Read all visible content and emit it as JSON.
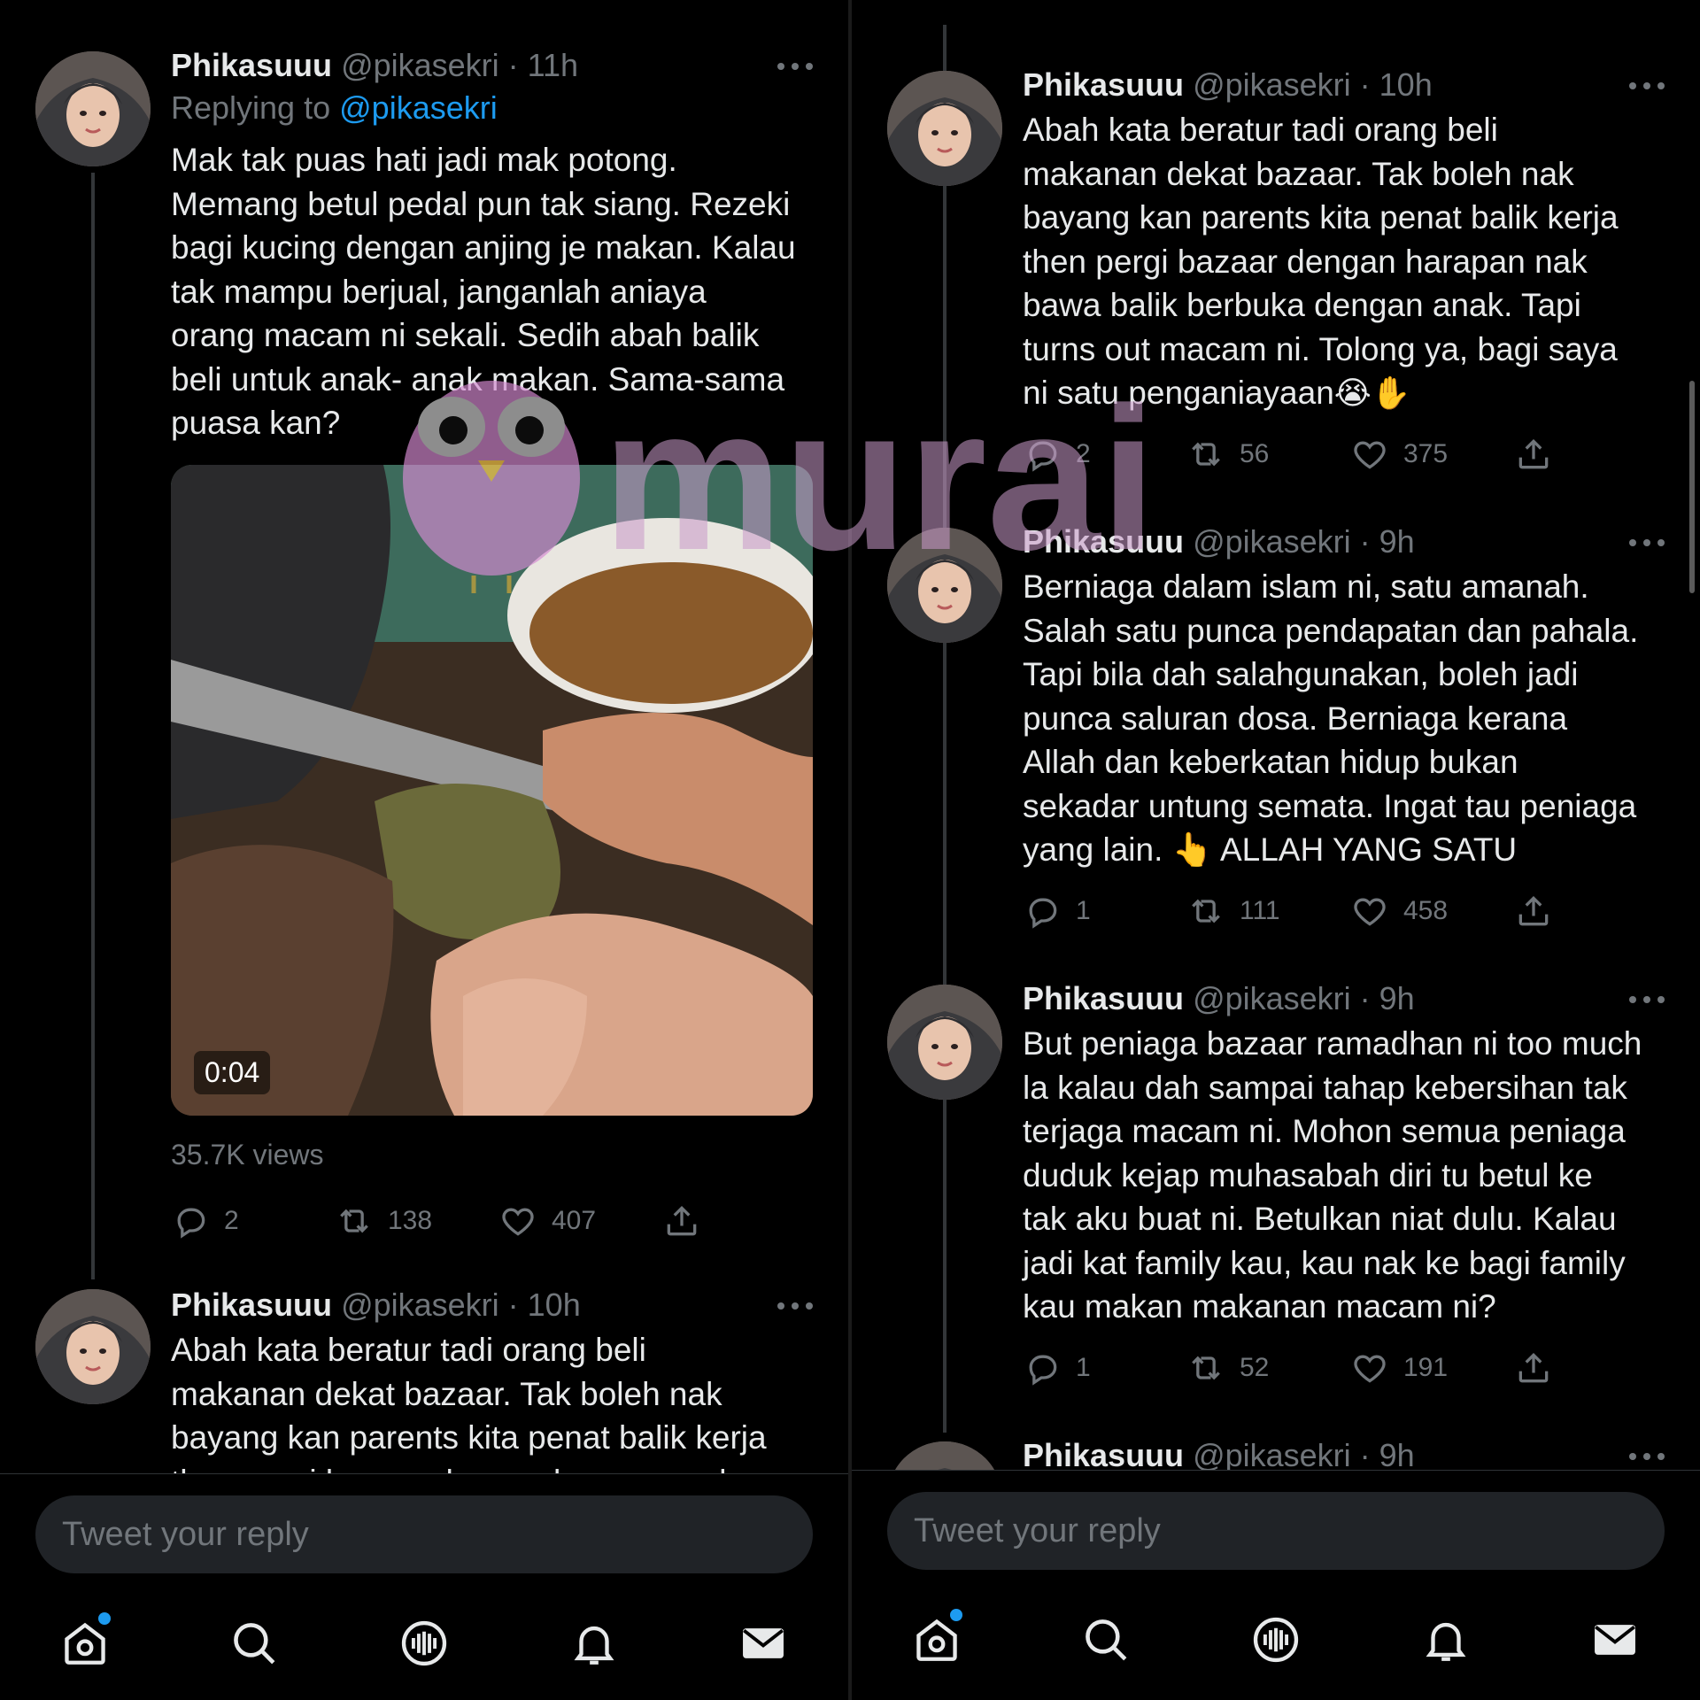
{
  "left": {
    "tweets": [
      {
        "name": "Phikasuuu",
        "handle": "@pikasekri",
        "time": "· 11h",
        "replying_label": "Replying to",
        "replying_handle": "@pikasekri",
        "text": "Mak tak puas hati jadi mak potong.\nMemang betul pedal pun tak siang. Rezeki\nbagi kucing dengan anjing je makan. Kalau\ntak mampu berjual, janganlah aniaya\norang macam ni sekali. Sedih abah balik\nbeli untuk anak- anak makan. Sama-sama\npuasa kan?",
        "video_duration": "0:04",
        "views": "35.7K views",
        "replies": "2",
        "retweets": "138",
        "likes": "407"
      },
      {
        "name": "Phikasuuu",
        "handle": "@pikasekri",
        "time": "· 10h",
        "text": "Abah kata beratur tadi orang beli\nmakanan dekat bazaar. Tak boleh nak\nbayang kan parents kita penat balik kerja\nthen pergi bazaar dengan harapan nak"
      }
    ],
    "reply_placeholder": "Tweet your reply"
  },
  "right": {
    "tweets": [
      {
        "name": "Phikasuuu",
        "handle": "@pikasekri",
        "time": "· 10h",
        "text": "Abah kata beratur tadi orang beli\nmakanan dekat bazaar. Tak boleh nak\nbayang kan parents kita penat balik kerja\nthen pergi bazaar dengan harapan nak\nbawa balik berbuka dengan anak. Tapi\nturns out macam ni. Tolong ya, bagi saya\nni satu penganiayaan",
        "emoji": "😭✋",
        "replies": "2",
        "retweets": "56",
        "likes": "375"
      },
      {
        "name": "Phikasuuu",
        "handle": "@pikasekri",
        "time": "· 9h",
        "text": "Berniaga dalam islam ni, satu amanah.\nSalah satu punca pendapatan dan pahala.\nTapi bila dah salahgunakan, boleh jadi\npunca saluran dosa. Berniaga kerana\nAllah dan keberkatan hidup bukan\nsekadar untung semata. Ingat tau peniaga\nyang lain. 👆 ALLAH YANG SATU",
        "replies": "1",
        "retweets": "111",
        "likes": "458"
      },
      {
        "name": "Phikasuuu",
        "handle": "@pikasekri",
        "time": "· 9h",
        "text": "But peniaga bazaar ramadhan ni too much\nla kalau dah sampai tahap kebersihan tak\nterjaga macam ni. Mohon semua peniaga\nduduk kejap muhasabah diri tu betul ke\ntak aku buat ni. Betulkan niat dulu. Kalau\njadi kat family kau, kau nak ke bagi family\nkau makan makanan macam ni?",
        "replies": "1",
        "retweets": "52",
        "likes": "191"
      },
      {
        "name": "Phikasuuu",
        "handle": "@pikasekri",
        "time": "· 9h"
      }
    ],
    "reply_placeholder": "Tweet your reply"
  },
  "watermark": {
    "text": "murai"
  },
  "icons": {
    "more": "more-icon",
    "reply": "reply-icon",
    "retweet": "retweet-icon",
    "like": "heart-icon",
    "share": "share-icon",
    "nav": [
      "home-icon",
      "search-icon",
      "spaces-icon",
      "bell-icon",
      "mail-icon"
    ]
  },
  "colors": {
    "accent": "#1d9bf0",
    "muted": "#71767b",
    "text": "#e7e9ea",
    "background": "#000000"
  }
}
